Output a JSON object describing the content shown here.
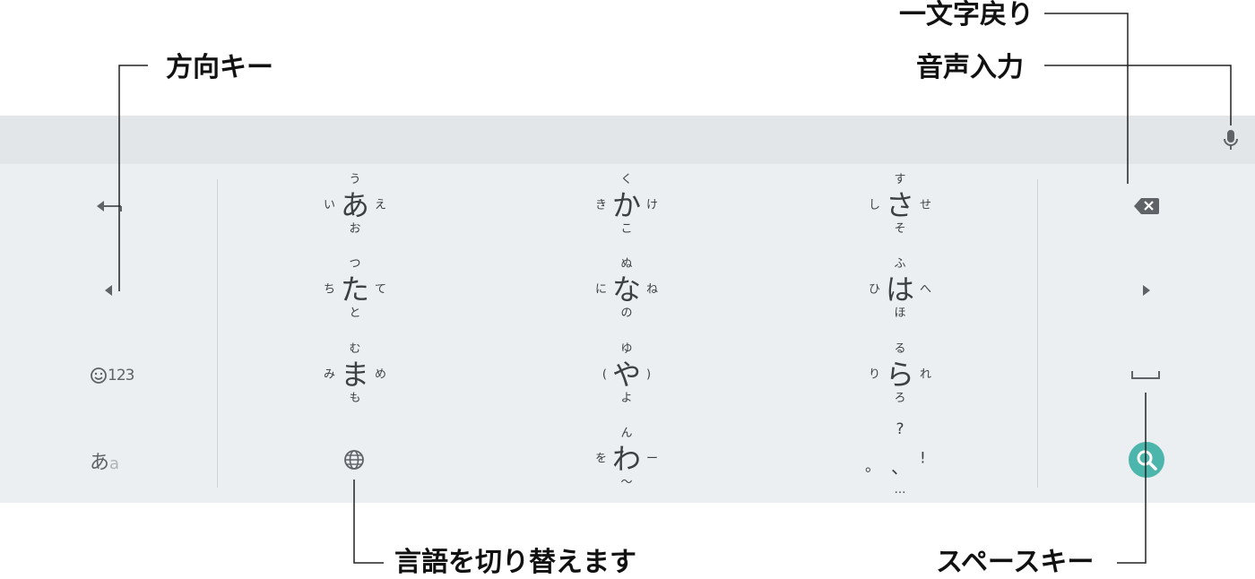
{
  "callouts": {
    "backspace": "一文字戻り",
    "voice": "音声入力",
    "direction": "方向キー",
    "language": "言語を切り替えます",
    "space": "スペースキー"
  },
  "left_column": {
    "num_label": "123",
    "mode_main": "あ",
    "mode_sub": "a"
  },
  "keys": [
    {
      "main": "あ",
      "top": "う",
      "bottom": "お",
      "left": "い",
      "right": "え"
    },
    {
      "main": "か",
      "top": "く",
      "bottom": "こ",
      "left": "き",
      "right": "け"
    },
    {
      "main": "さ",
      "top": "す",
      "bottom": "そ",
      "left": "し",
      "right": "せ"
    },
    {
      "main": "た",
      "top": "つ",
      "bottom": "と",
      "left": "ち",
      "right": "て"
    },
    {
      "main": "な",
      "top": "ぬ",
      "bottom": "の",
      "left": "に",
      "right": "ね"
    },
    {
      "main": "は",
      "top": "ふ",
      "bottom": "ほ",
      "left": "ひ",
      "right": "へ"
    },
    {
      "main": "ま",
      "top": "む",
      "bottom": "も",
      "left": "み",
      "right": "め"
    },
    {
      "main": "や",
      "top": "ゆ",
      "bottom": "よ",
      "left": "(",
      "right": ")"
    },
    {
      "main": "ら",
      "top": "る",
      "bottom": "ろ",
      "left": "り",
      "right": "れ"
    },
    {
      "main": "わ",
      "top": "ん",
      "bottom": "〜",
      "left": "を",
      "right": "ー"
    },
    {
      "main": "、",
      "top": "?",
      "bottom": "…",
      "left": "。",
      "right": "!"
    }
  ],
  "colors": {
    "accent": "#4db6ac",
    "keyboard_bg": "#eceff1",
    "top_bar_bg": "#e3e6e8"
  },
  "icons": [
    "backspace-icon",
    "mic-icon",
    "left-arrow-icon",
    "cursor-left-icon",
    "cursor-right-icon",
    "emoji-icon",
    "globe-icon",
    "space-icon",
    "search-icon"
  ]
}
